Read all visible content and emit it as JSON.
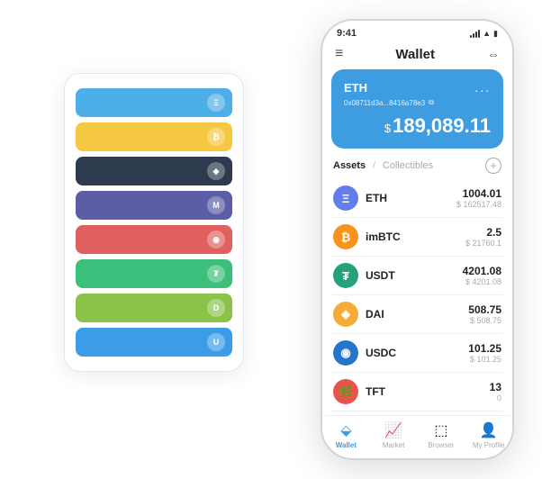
{
  "app": {
    "title": "Wallet"
  },
  "phone": {
    "status_time": "9:41",
    "header_title": "Wallet",
    "eth_card": {
      "label": "ETH",
      "address": "0x08711d3a...8416a78e3",
      "balance_symbol": "$",
      "balance": "189,089.11",
      "dots": "..."
    },
    "assets_tab_active": "Assets",
    "assets_tab_divider": "/",
    "assets_tab_inactive": "Collectibles",
    "assets": [
      {
        "name": "ETH",
        "amount": "1004.01",
        "value": "$ 162517.48",
        "color": "#627EEA",
        "symbol": "Ξ"
      },
      {
        "name": "imBTC",
        "amount": "2.5",
        "value": "$ 21760.1",
        "color": "#F7931A",
        "symbol": "₿"
      },
      {
        "name": "USDT",
        "amount": "4201.08",
        "value": "$ 4201.08",
        "color": "#26A17B",
        "symbol": "₮"
      },
      {
        "name": "DAI",
        "amount": "508.75",
        "value": "$ 508.75",
        "color": "#F5AC37",
        "symbol": "◈"
      },
      {
        "name": "USDC",
        "amount": "101.25",
        "value": "$ 101.25",
        "color": "#2775CA",
        "symbol": "◉"
      },
      {
        "name": "TFT",
        "amount": "13",
        "value": "0",
        "color": "#E8534A",
        "symbol": "🌿"
      }
    ],
    "nav": [
      {
        "label": "Wallet",
        "icon": "⬙",
        "active": true
      },
      {
        "label": "Market",
        "icon": "📈",
        "active": false
      },
      {
        "label": "Browser",
        "icon": "⬚",
        "active": false
      },
      {
        "label": "My Profile",
        "icon": "👤",
        "active": false
      }
    ]
  },
  "card_stack": {
    "rows": [
      {
        "color": "#4EAEE8",
        "icon": "Ξ"
      },
      {
        "color": "#F5C842",
        "icon": "₿"
      },
      {
        "color": "#2E3A4E",
        "icon": "◈"
      },
      {
        "color": "#5B5EA6",
        "icon": "M"
      },
      {
        "color": "#E06060",
        "icon": "◉"
      },
      {
        "color": "#3BBF7A",
        "icon": "₮"
      },
      {
        "color": "#8BC34A",
        "icon": "D"
      },
      {
        "color": "#3B9DE8",
        "icon": "U"
      }
    ]
  }
}
